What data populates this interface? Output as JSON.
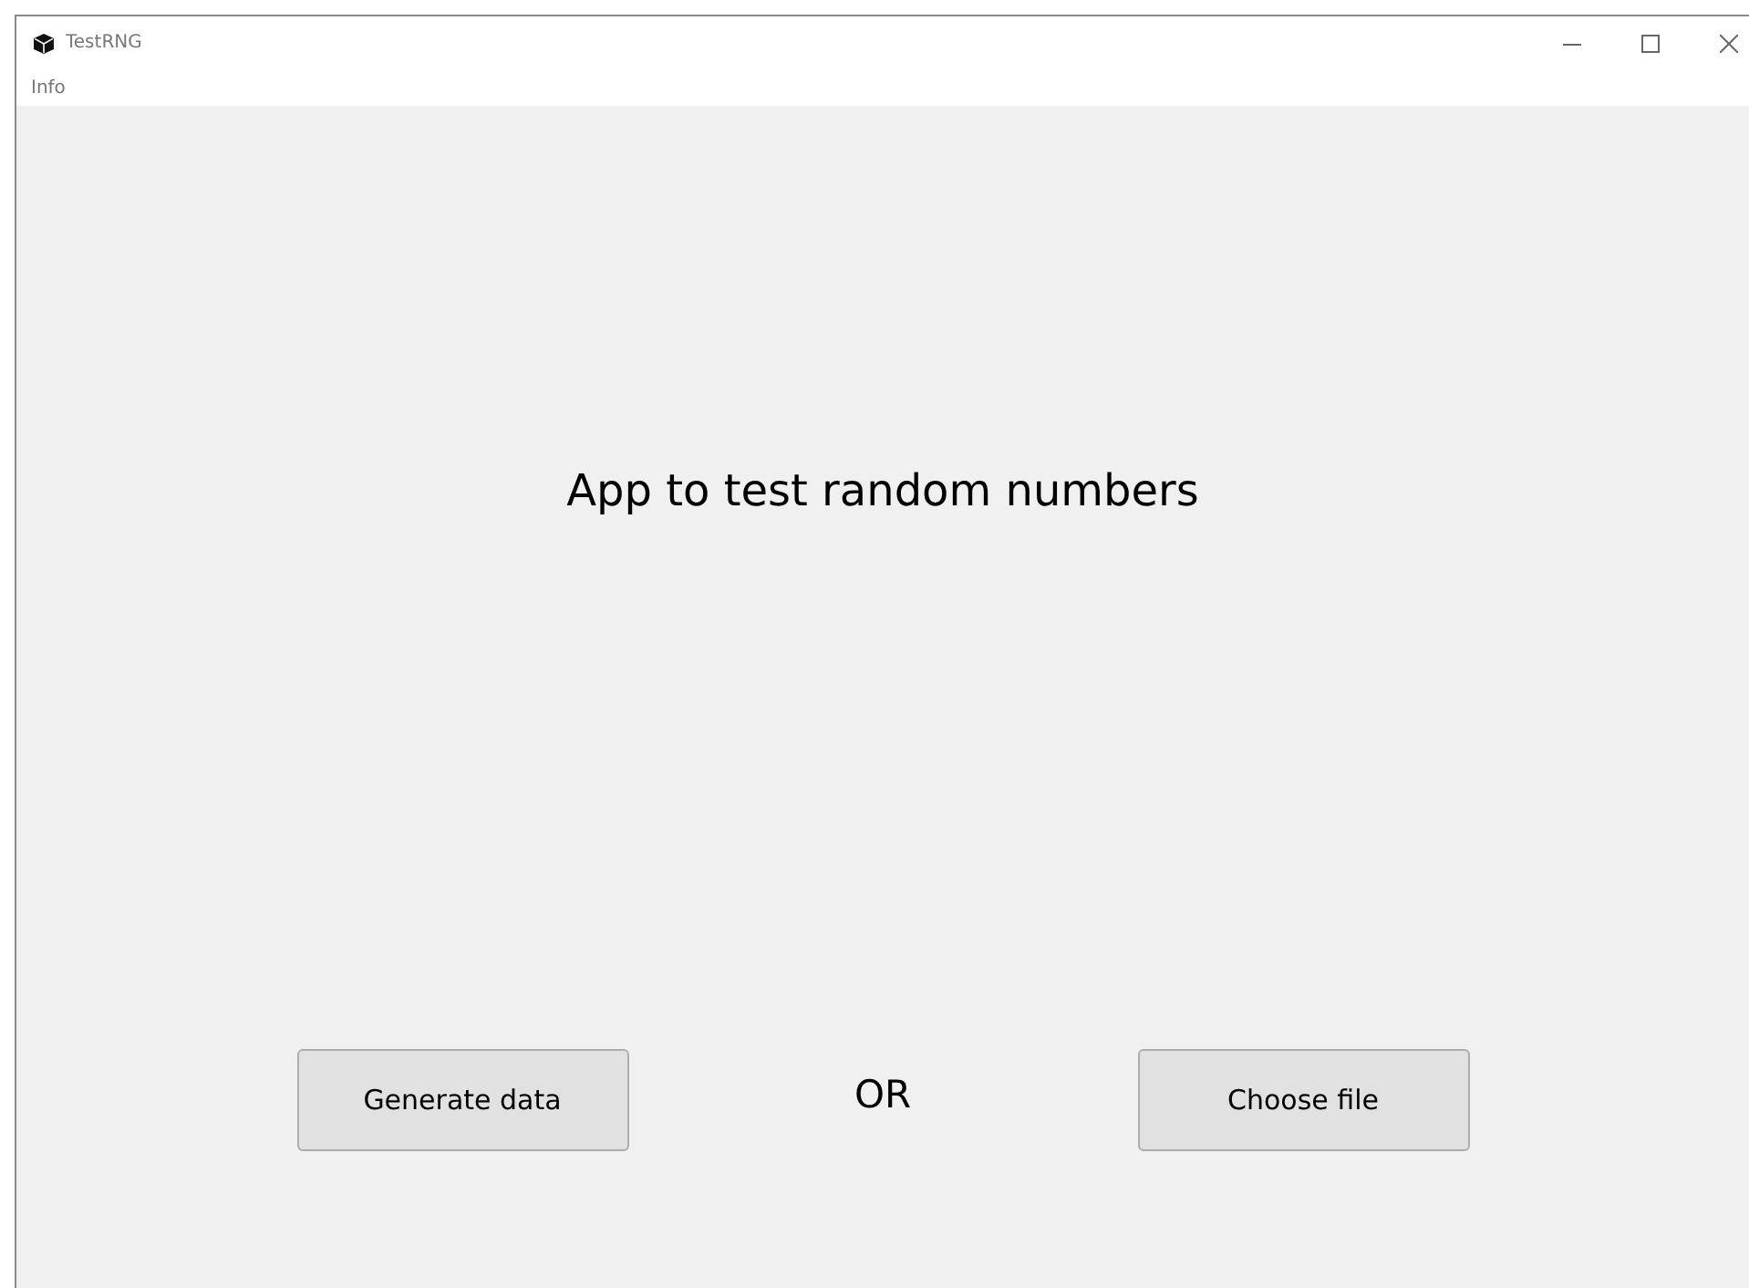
{
  "window": {
    "title": "TestRNG"
  },
  "menu": [
    "Info"
  ],
  "heading": "App to test random numbers",
  "buttons": [
    {
      "label": "Generate data"
    },
    {
      "label": "Choose file"
    }
  ],
  "separator": "OR"
}
